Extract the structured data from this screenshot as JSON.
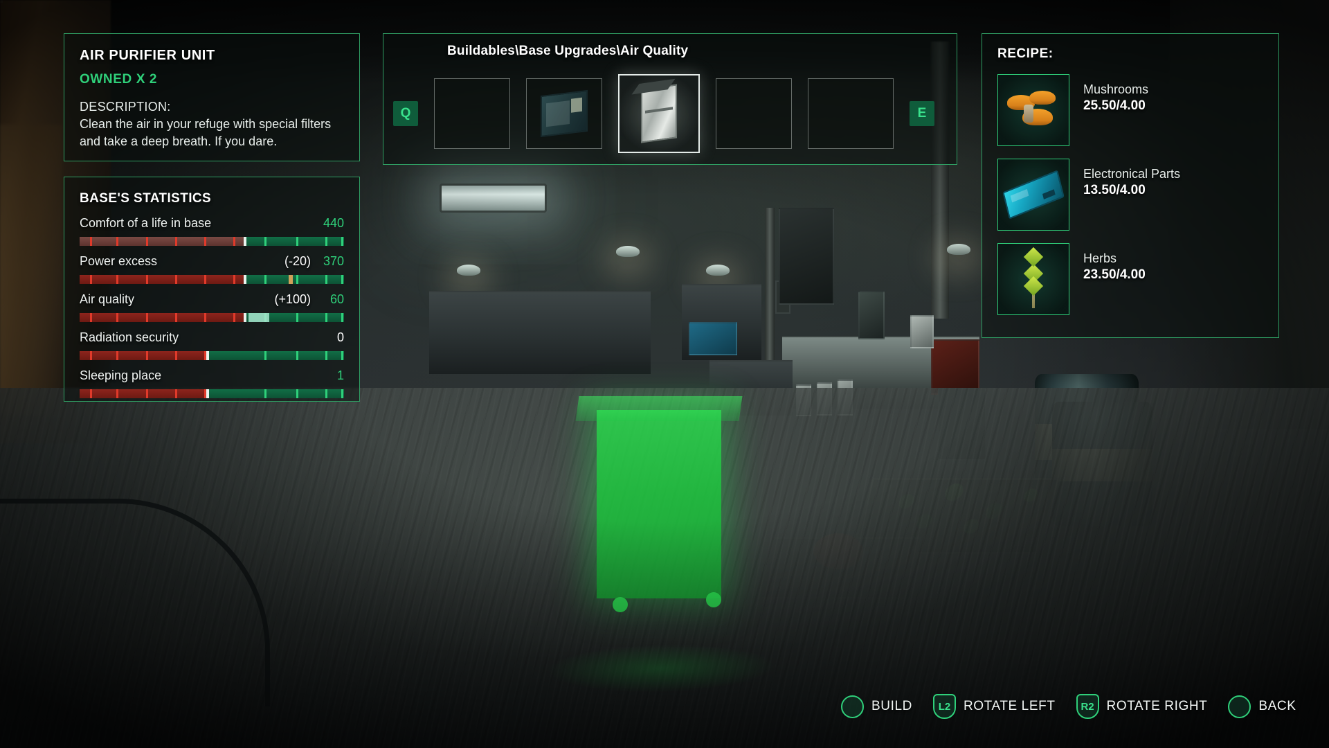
{
  "info": {
    "title": "AIR PURIFIER UNIT",
    "owned": "OWNED X 2",
    "description_label": "DESCRIPTION:",
    "description": "Clean the air in your refuge with special filters and take a deep breath. If you dare."
  },
  "stats": {
    "title": "BASE'S STATISTICS",
    "rows": [
      {
        "name": "Comfort of a life in base",
        "delta": "",
        "value": "440",
        "value_color": "#2fd07a",
        "fill_percent": 62,
        "marker_percent": 62
      },
      {
        "name": "Power excess",
        "delta": "(-20)",
        "value": "370",
        "value_color": "#2fd07a",
        "fill_percent": 62,
        "marker_percent": 62
      },
      {
        "name": "Air quality",
        "delta": "(+100)",
        "value": "60",
        "value_color": "#2fd07a",
        "fill_percent": 62,
        "marker_percent": 62
      },
      {
        "name": "Radiation security",
        "delta": "",
        "value": "0",
        "value_color": "#ffffff",
        "fill_percent": 48,
        "marker_percent": 48
      },
      {
        "name": "Sleeping place",
        "delta": "",
        "value": "1",
        "value_color": "#2fd07a",
        "fill_percent": 48,
        "marker_percent": 48
      }
    ]
  },
  "buildables": {
    "path": "Buildables\\Base Upgrades\\Air Quality",
    "prev_key": "Q",
    "next_key": "E",
    "slots": [
      {
        "name": "slot-empty-1",
        "icon": "none",
        "selected": false
      },
      {
        "name": "slot-air-filter-box",
        "icon": "box",
        "selected": false
      },
      {
        "name": "slot-air-purifier-unit",
        "icon": "cabinet",
        "selected": true
      },
      {
        "name": "slot-empty-4",
        "icon": "none",
        "selected": false
      },
      {
        "name": "slot-empty-5",
        "icon": "none",
        "selected": false
      }
    ]
  },
  "recipe": {
    "title": "RECIPE:",
    "items": [
      {
        "name": "Mushrooms",
        "amount": "25.50/4.00",
        "icon": "mushroom-icon"
      },
      {
        "name": "Electronical Parts",
        "amount": "13.50/4.00",
        "icon": "circuit-board-icon"
      },
      {
        "name": "Herbs",
        "amount": "23.50/4.00",
        "icon": "herb-icon"
      }
    ]
  },
  "controls": [
    {
      "button": "",
      "glyph": "circle",
      "label": "BUILD"
    },
    {
      "button": "L2",
      "glyph": "trigger",
      "label": "ROTATE LEFT"
    },
    {
      "button": "R2",
      "glyph": "trigger",
      "label": "ROTATE RIGHT"
    },
    {
      "button": "",
      "glyph": "circle",
      "label": "BACK"
    }
  ],
  "theme": {
    "accent_green": "#2fd07a",
    "panel_border": "#2f9e63",
    "bar_red": "#8d241c",
    "bar_green": "#116e46",
    "hologram": "#22d84e"
  }
}
